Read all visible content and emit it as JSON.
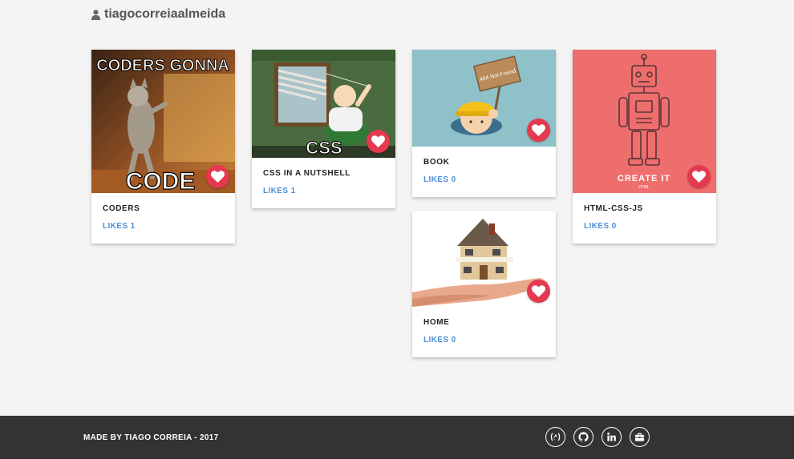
{
  "header": {
    "username": "tiagocorreiaalmeida",
    "icon": "user-icon"
  },
  "cards": [
    {
      "title": "CODERS",
      "likes": "LIKES 1",
      "image_caption_top": "CODERS GONNA",
      "image_caption_bottom": "CODE"
    },
    {
      "title": "CSS IN A NUTSHELL",
      "likes": "LIKES 1",
      "image_caption": "CSS"
    },
    {
      "title": "BOOK",
      "likes": "LIKES 0",
      "image_caption": "404 Not Found"
    },
    {
      "title": "HOME",
      "likes": "LIKES 0"
    },
    {
      "title": "HTML-CSS-JS",
      "likes": "LIKES 0",
      "image_caption": "CREATE IT",
      "image_subcaption": "HTML"
    }
  ],
  "footer": {
    "credit": "MADE BY TIAGO CORREIA - 2017",
    "links": [
      "freecodecamp-icon",
      "github-icon",
      "linkedin-icon",
      "portfolio-icon"
    ]
  },
  "colors": {
    "heart": "#e53950",
    "likes": "#4a90d9",
    "footer": "#333333",
    "background": "#f4f4f4"
  }
}
